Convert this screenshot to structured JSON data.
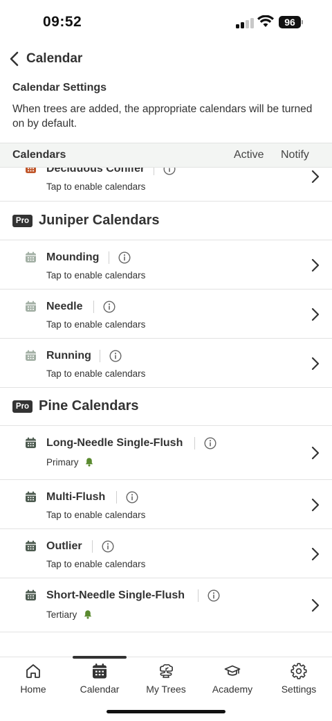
{
  "status_bar": {
    "time": "09:52",
    "battery": "96"
  },
  "nav": {
    "title": "Calendar"
  },
  "settings": {
    "title": "Calendar Settings",
    "description": "When trees are added, the appropriate calendars will be turned on by default."
  },
  "table_header": {
    "calendars": "Calendars",
    "active": "Active",
    "notify": "Notify"
  },
  "rows": {
    "deciduous_conifer": {
      "title": "Deciduous Conifer",
      "subtitle": "Tap to enable calendars"
    },
    "mounding": {
      "title": "Mounding",
      "subtitle": "Tap to enable calendars"
    },
    "needle": {
      "title": "Needle",
      "subtitle": "Tap to enable calendars"
    },
    "running": {
      "title": "Running",
      "subtitle": "Tap to enable calendars"
    },
    "long_needle": {
      "title": "Long-Needle Single-Flush",
      "subtitle": "Primary"
    },
    "multi_flush": {
      "title": "Multi-Flush",
      "subtitle": "Tap to enable calendars"
    },
    "outlier": {
      "title": "Outlier",
      "subtitle": "Tap to enable calendars"
    },
    "short_needle": {
      "title": "Short-Needle Single-Flush",
      "subtitle": "Tertiary"
    }
  },
  "sections": {
    "juniper": {
      "badge": "Pro",
      "title": "Juniper Calendars"
    },
    "pine": {
      "badge": "Pro",
      "title": "Pine Calendars"
    }
  },
  "tabs": {
    "home": "Home",
    "calendar": "Calendar",
    "my_trees": "My Trees",
    "academy": "Academy",
    "settings": "Settings"
  },
  "colors": {
    "calendar_icon_orange": "#c0562a",
    "calendar_icon_inactive": "#a3b0a5",
    "calendar_icon_active": "#4d5b50",
    "bell_green": "#5a8a2f",
    "text_primary": "#333333"
  },
  "icons": {
    "status": [
      "cellular-signal-icon",
      "wifi-icon",
      "battery-icon"
    ],
    "rows": [
      "calendar-icon",
      "info-icon",
      "chevron-right-icon",
      "bell-icon"
    ],
    "tabs": [
      "home-icon",
      "calendar-icon",
      "trees-icon",
      "graduation-cap-icon",
      "gear-icon"
    ]
  }
}
